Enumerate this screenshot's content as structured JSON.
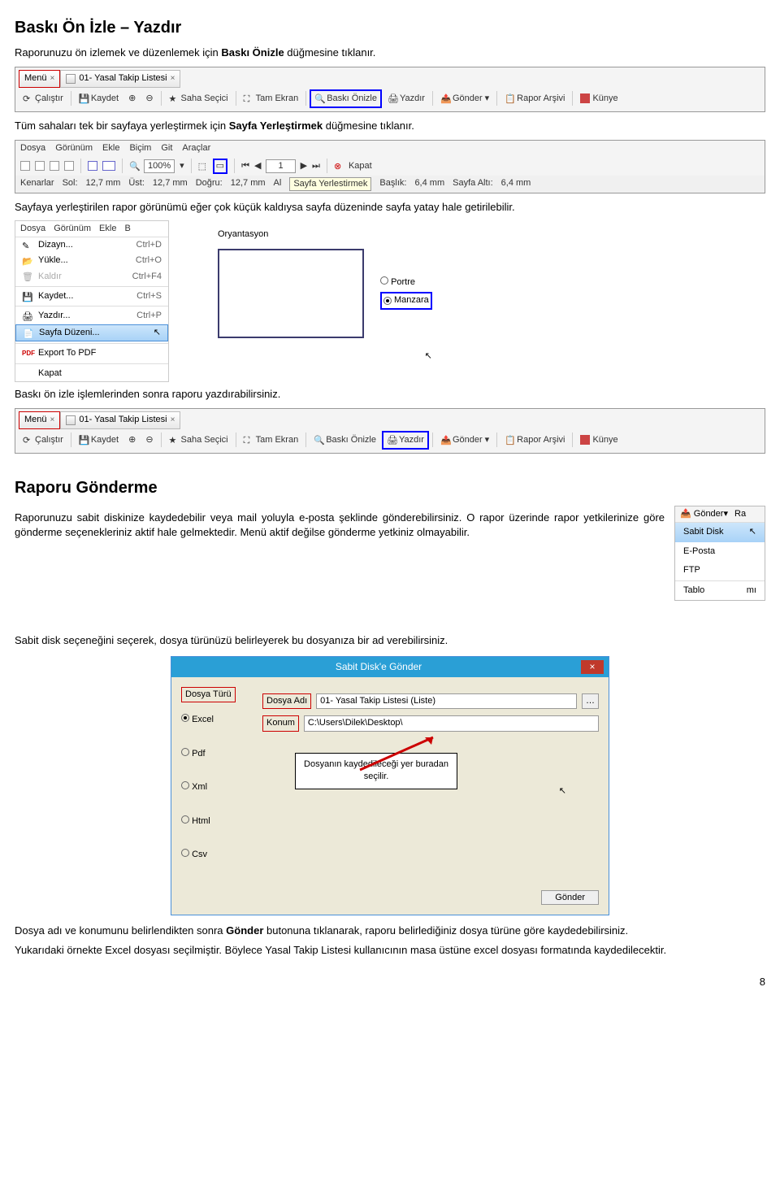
{
  "heading1": "Baskı Ön İzle – Yazdır",
  "p1a": "Raporunuzu ön izlemek ve düzenlemek için ",
  "p1b": "Baskı Önizle",
  "p1c": " düğmesine tıklanır.",
  "tabs": {
    "menu": "Menü",
    "list": "01- Yasal Takip Listesi"
  },
  "toolbar": {
    "calistir": "Çalıştır",
    "kaydet": "Kaydet",
    "saha": "Saha Seçici",
    "tam": "Tam Ekran",
    "baski": "Baskı Önizle",
    "yazdir": "Yazdır",
    "gonder": "Gönder",
    "rapor": "Rapor Arşivi",
    "kunye": "Künye"
  },
  "p2a": "Tüm sahaları tek bir sayfaya yerleştirmek için ",
  "p2b": "Sayfa Yerleştirmek",
  "p2c": " düğmesine tıklanır.",
  "topmenu": {
    "dosya": "Dosya",
    "gorunum": "Görünüm",
    "ekle": "Ekle",
    "bicim": "Biçim",
    "git": "Git",
    "araclar": "Araçlar"
  },
  "margins": {
    "kenarlar": "Kenarlar",
    "sol": "Sol:",
    "solv": "12,7 mm",
    "ust": "Üst:",
    "ustv": "12,7 mm",
    "dogru": "Doğru:",
    "dogruv": "12,7 mm",
    "al": "Al",
    "sayfay": "Sayfa Yerlestirmek",
    "baslik": "Başlık:",
    "baslikv": "6,4 mm",
    "sayfalt": "Sayfa Altı:",
    "sayfaltv": "6,4 mm",
    "zoom": "100%",
    "page": "1",
    "kapat": "Kapat"
  },
  "p3": "Sayfaya yerleştirilen rapor görünümü eğer çok küçük kaldıysa sayfa düzeninde sayfa yatay hale getirilebilir.",
  "filemenu": {
    "dizayn": "Dizayn...",
    "dizaynsc": "Ctrl+D",
    "yukle": "Yükle...",
    "yuklesc": "Ctrl+O",
    "kaldir": "Kaldır",
    "kaldirsc": "Ctrl+F4",
    "kaydet": "Kaydet...",
    "kaydetsc": "Ctrl+S",
    "yazdir": "Yazdır...",
    "yazdirsc": "Ctrl+P",
    "sayfaduzeni": "Sayfa Düzeni...",
    "export": "Export To PDF",
    "kapat": "Kapat",
    "top1": "Dosya",
    "top2": "Görünüm",
    "top3": "Ekle",
    "top4": "B"
  },
  "orient": {
    "title": "Oryantasyon",
    "portre": "Portre",
    "manzara": "Manzara"
  },
  "p4": "Baskı ön izle işlemlerinden sonra raporu yazdırabilirsiniz.",
  "heading2": "Raporu Gönderme",
  "p5": "Raporunuzu sabit diskinize kaydedebilir veya mail yoluyla e-posta şeklinde gönderebilirsiniz. O rapor üzerinde rapor yetkilerinize göre gönderme seçenekleriniz aktif hale gelmektedir. Menü aktif değilse gönderme yetkiniz olmayabilir.",
  "gondermenu": {
    "top1": "Gönder",
    "top2": "Ra",
    "i1": "Sabit Disk",
    "i2": "E-Posta",
    "i3": "FTP",
    "i4": "Tablo",
    "m": "mı"
  },
  "p6": "Sabit disk seçeneğini seçerek, dosya türünüzü belirleyerek bu dosyanıza bir ad verebilirsiniz.",
  "dialog": {
    "title": "Sabit Disk'e Gönder",
    "dosyaturu": "Dosya Türü",
    "excel": "Excel",
    "pdf": "Pdf",
    "xml": "Xml",
    "html": "Html",
    "csv": "Csv",
    "dosyaadi": "Dosya Adı",
    "dosyaadiv": "01- Yasal Takip Listesi (Liste)",
    "konum": "Konum",
    "konumv": "C:\\Users\\Dilek\\Desktop\\",
    "note": "Dosyanın kaydedileceği yer buradan seçilir.",
    "gonder": "Gönder"
  },
  "p7a": "Dosya adı ve konumunu belirlendikten sonra ",
  "p7b": "Gönder",
  "p7c": " butonuna tıklanarak, raporu belirlediğiniz dosya türüne göre kaydedebilirsiniz.",
  "p8": "Yukarıdaki örnekte Excel dosyası seçilmiştir. Böylece Yasal Takip Listesi kullanıcının masa üstüne excel dosyası formatında kaydedilecektir.",
  "pagenum": "8"
}
